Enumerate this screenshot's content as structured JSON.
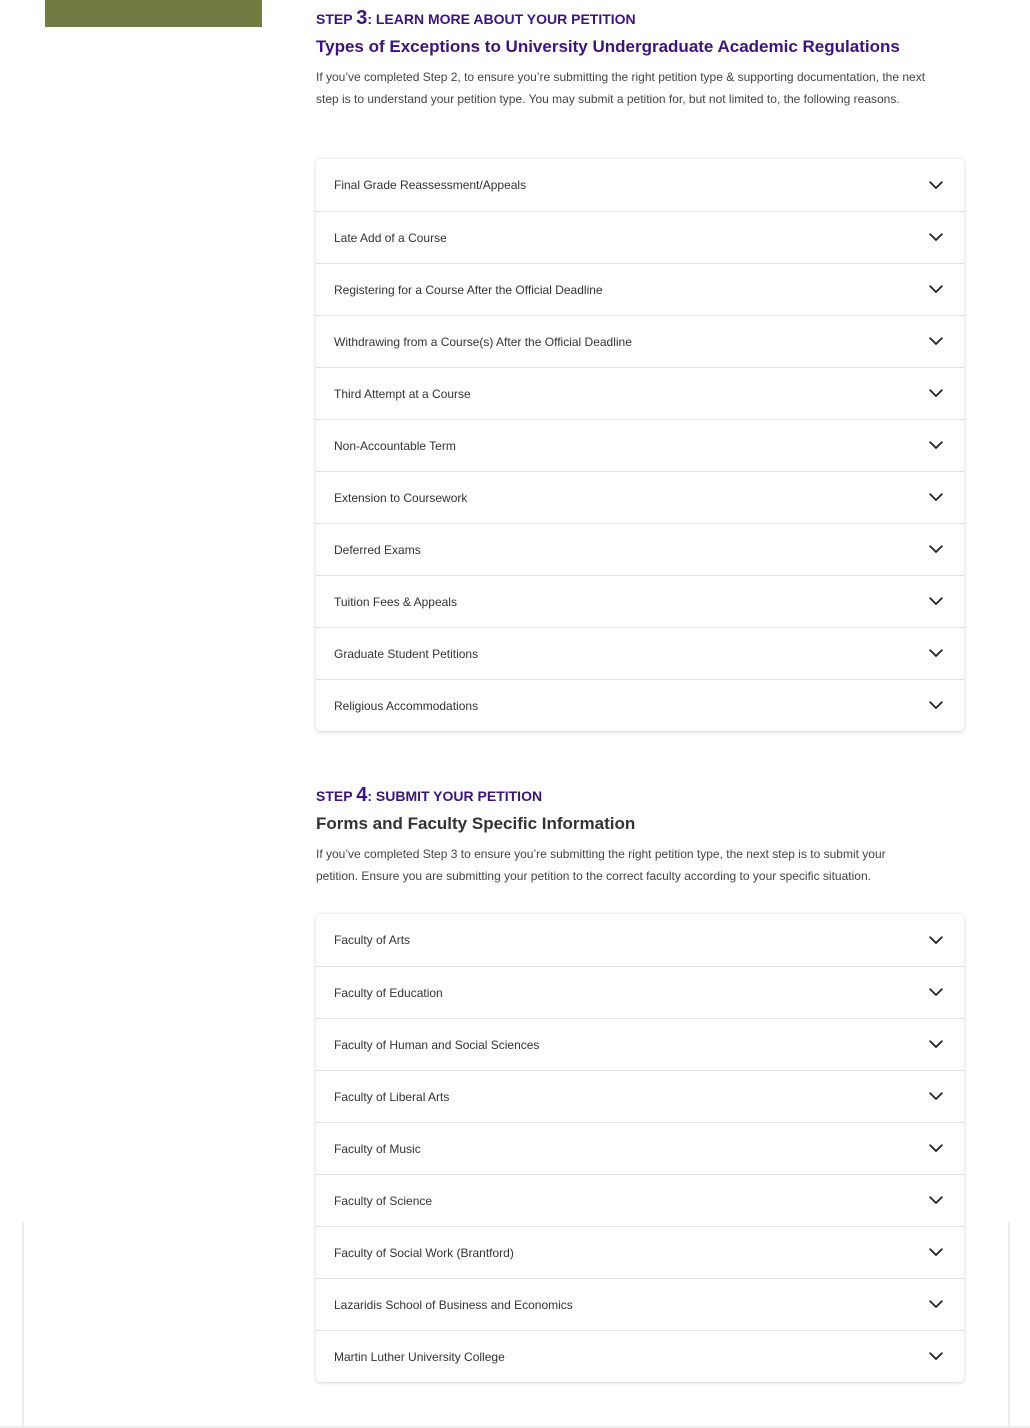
{
  "colors": {
    "accent_purple": "#3b1578",
    "heading_dark": "#333333",
    "olive_block": "#737b45"
  },
  "step3": {
    "heading_prefix": "Step ",
    "heading_number": "3",
    "heading_suffix": ": Learn more about your petition",
    "subheading": "Types of Exceptions to University Undergraduate Academic Regulations",
    "intro": "If you’ve completed Step 2, to ensure you’re submitting the right petition type & supporting documentation, the next step is to understand your petition type. You may submit a petition for, but not limited to, the following reasons.",
    "items": [
      {
        "label": "Final Grade Reassessment/Appeals",
        "icon": "chevron-down-icon"
      },
      {
        "label": "Late Add of a Course",
        "icon": "chevron-down-icon"
      },
      {
        "label": "Registering for a Course After the Official Deadline",
        "icon": "chevron-down-icon"
      },
      {
        "label": "Withdrawing from a Course(s) After the Official Deadline",
        "icon": "chevron-down-icon"
      },
      {
        "label": "Third Attempt at a Course",
        "icon": "chevron-down-icon"
      },
      {
        "label": "Non-Accountable Term",
        "icon": "chevron-down-icon"
      },
      {
        "label": "Extension to Coursework",
        "icon": "chevron-down-icon"
      },
      {
        "label": "Deferred Exams",
        "icon": "chevron-down-icon"
      },
      {
        "label": "Tuition Fees & Appeals",
        "icon": "chevron-down-icon"
      },
      {
        "label": "Graduate Student Petitions",
        "icon": "chevron-down-icon"
      },
      {
        "label": "Religious Accommodations",
        "icon": "chevron-down-icon"
      }
    ]
  },
  "step4": {
    "heading_prefix": "Step ",
    "heading_number": "4",
    "heading_suffix": ": Submit your petition",
    "subheading": "Forms and Faculty Specific Information",
    "intro": "If you’ve completed Step 3 to ensure you’re submitting the right petition type, the next step is to submit your petition. Ensure you are submitting your petition to the correct faculty according to your specific situation.",
    "items": [
      {
        "label": "Faculty of Arts",
        "icon": "chevron-down-icon"
      },
      {
        "label": "Faculty of Education",
        "icon": "chevron-down-icon"
      },
      {
        "label": "Faculty of Human and Social Sciences",
        "icon": "chevron-down-icon"
      },
      {
        "label": "Faculty of Liberal Arts",
        "icon": "chevron-down-icon"
      },
      {
        "label": "Faculty of Music",
        "icon": "chevron-down-icon"
      },
      {
        "label": "Faculty of Science",
        "icon": "chevron-down-icon"
      },
      {
        "label": "Faculty of Social Work (Brantford)",
        "icon": "chevron-down-icon"
      },
      {
        "label": "Lazaridis School of Business and Economics",
        "icon": "chevron-down-icon"
      },
      {
        "label": "Martin Luther University College",
        "icon": "chevron-down-icon"
      }
    ]
  }
}
